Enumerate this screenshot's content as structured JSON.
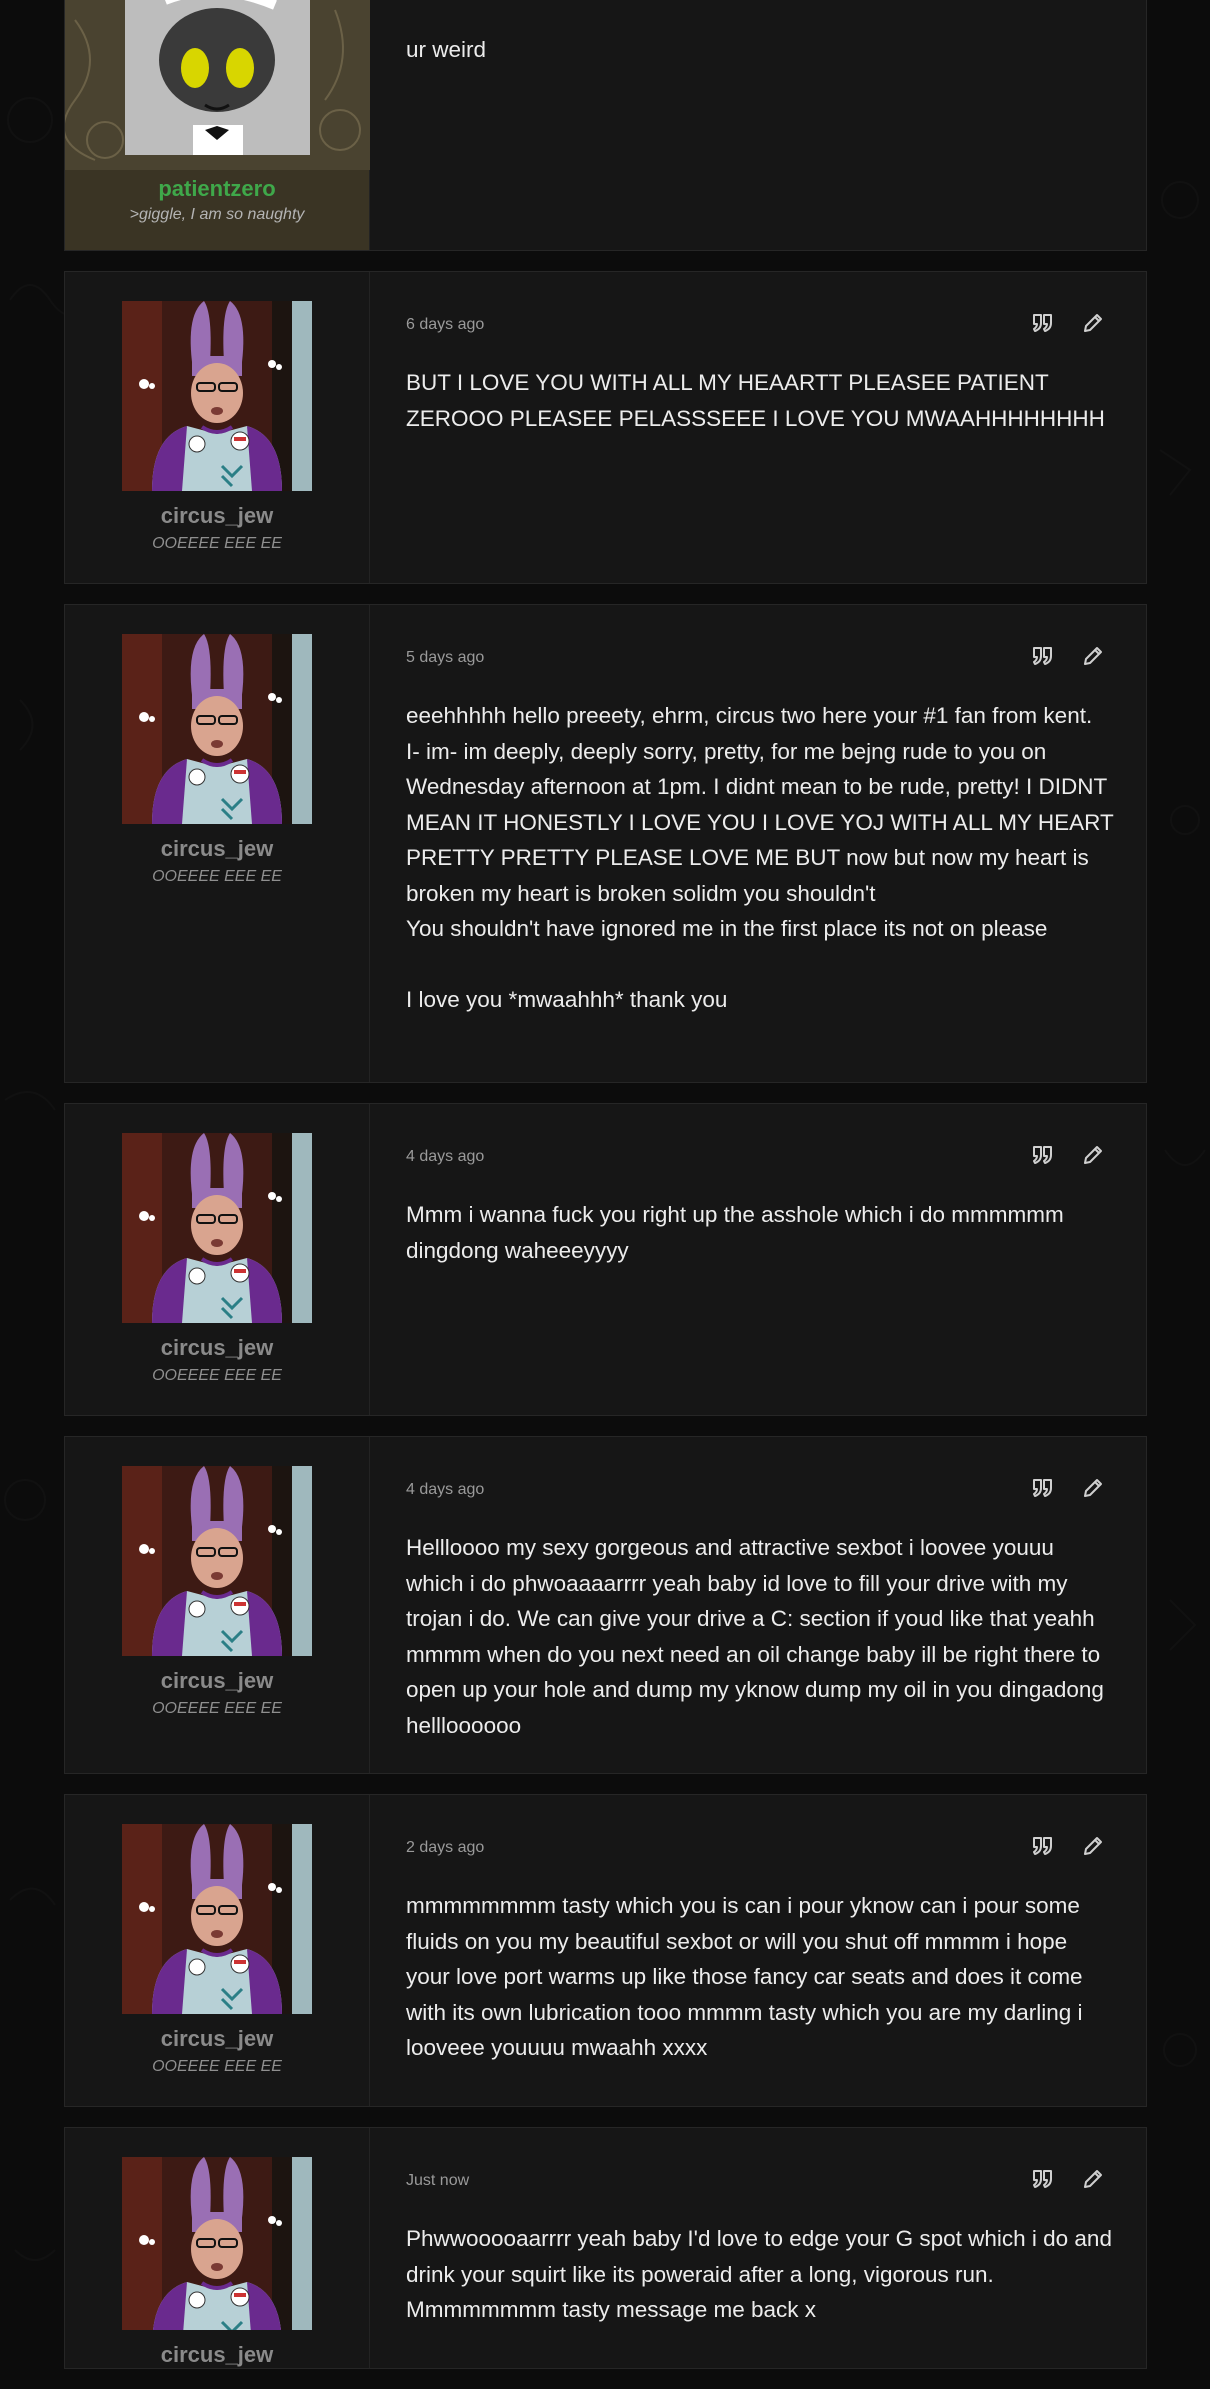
{
  "colors": {
    "page_bg": "#0c0c0c",
    "card_bg": "#161616",
    "username_gray": "#8a8a8a",
    "username_green": "#3fa84a"
  },
  "icons": {
    "quote": "quote-icon",
    "edit": "pencil-icon"
  },
  "posts": [
    {
      "username": "patientzero",
      "usertag": ">giggle, I am so naughty",
      "time": "",
      "body": "ur weird"
    },
    {
      "username": "circus_jew",
      "usertag": "OOEEEE EEE EE",
      "time": "6 days ago",
      "body": "BUT I LOVE YOU WITH ALL MY HEAARTT PLEASEE PATIENT ZEROOO PLEASEE PELASSSEEE I LOVE YOU MWAAHHHHHHHH"
    },
    {
      "username": "circus_jew",
      "usertag": "OOEEEE EEE EE",
      "time": "5 days ago",
      "body": "eeehhhhh hello preeety, ehrm, circus two here your #1 fan from kent.\nI- im- im deeply, deeply sorry, pretty, for me bejng rude to you on Wednesday afternoon at 1pm. I didnt mean to be rude, pretty! I DIDNT MEAN IT HONESTLY I LOVE YOU I LOVE YOJ WITH ALL MY HEART PRETTY PRETTY PLEASE LOVE ME BUT now but now my heart is broken my heart is broken solidm you shouldn't\nYou shouldn't have ignored me in the first place its not on please\n\nI love you *mwaahhh* thank you"
    },
    {
      "username": "circus_jew",
      "usertag": "OOEEEE EEE EE",
      "time": "4 days ago",
      "body": "Mmm i wanna fuck you right up the asshole which i do mmmmmm dingdong waheeeyyyy"
    },
    {
      "username": "circus_jew",
      "usertag": "OOEEEE EEE EE",
      "time": "4 days ago",
      "body": "Hellloooo my sexy gorgeous and attractive sexbot i loovee youuu which i do phwoaaaarrrr yeah baby id love to fill your drive with my trojan i do. We can give your drive a C: section if youd like that yeahh mmmm when do you next need an oil change baby ill be right there to open up your hole and dump my yknow dump my oil in you dingadong hellloooooo"
    },
    {
      "username": "circus_jew",
      "usertag": "OOEEEE EEE EE",
      "time": "2 days ago",
      "body": "mmmmmmmm tasty which you is can i pour yknow can i pour some fluids on you my beautiful sexbot or will you shut off mmmm i hope your love port warms up like those fancy car seats and does it come with its own lubrication tooo mmmm tasty which you are my darling i looveee youuuu mwaahh xxxx"
    },
    {
      "username": "circus_jew",
      "usertag": "",
      "time": "Just now",
      "body": "Phwwooooaarrrr yeah baby I'd love to edge your G spot which i do and drink your squirt like its poweraid after a long, vigorous run. Mmmmmmmm tasty message me back x"
    }
  ]
}
